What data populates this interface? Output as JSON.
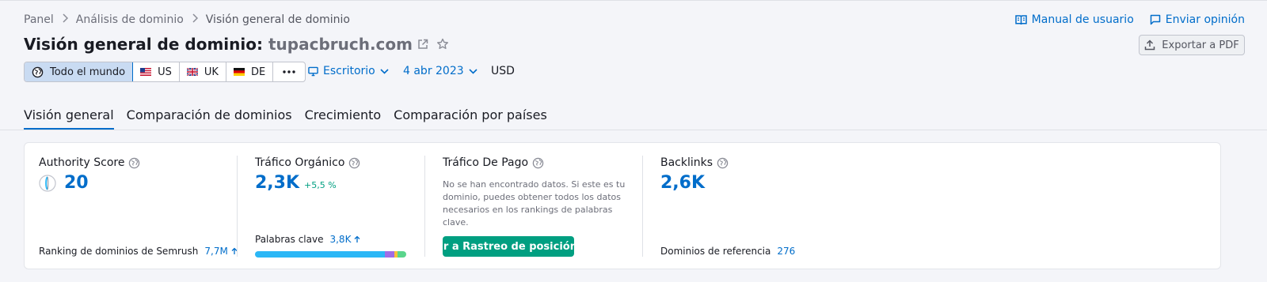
{
  "breadcrumb": [
    "Panel",
    "Análisis de dominio",
    "Visión general de dominio"
  ],
  "toplinks": {
    "manual": "Manual de usuario",
    "feedback": "Enviar opinión"
  },
  "title": {
    "prefix": "Visión general de dominio:",
    "domain": "tupacbruch.com"
  },
  "export_label": "Exportar a PDF",
  "databases": [
    {
      "label": "Todo el mundo",
      "active": true
    },
    {
      "label": "US"
    },
    {
      "label": "UK"
    },
    {
      "label": "DE"
    }
  ],
  "device": "Escritorio",
  "date": "4 abr 2023",
  "currency": "USD",
  "tabs": [
    "Visión general",
    "Comparación de dominios",
    "Crecimiento",
    "Comparación por países"
  ],
  "metrics": {
    "authority": {
      "label": "Authority Score",
      "value": "20",
      "rank_label": "Ranking de dominios de Semrush",
      "rank_value": "7,7M"
    },
    "organic": {
      "label": "Tráfico Orgánico",
      "value": "2,3K",
      "delta": "+5,5 %",
      "kw_label": "Palabras clave",
      "kw_value": "3,8K",
      "kw_distribution": [
        {
          "share": 0.857,
          "color": "#2bb7f6"
        },
        {
          "share": 0.065,
          "color": "#a06ce6"
        },
        {
          "share": 0.02,
          "color": "#f9c13a"
        },
        {
          "share": 0.058,
          "color": "#5ad58c"
        }
      ]
    },
    "paid": {
      "label": "Tráfico De Pago",
      "nodata": "No se han encontrado datos. Si este es tu dominio, puedes obtener todos los datos necesarios en los rankings de palabras clave.",
      "cta": "Ir a Rastreo de posición"
    },
    "backlinks": {
      "label": "Backlinks",
      "value": "2,6K",
      "ref_label": "Dominios de referencia",
      "ref_value": "276"
    }
  },
  "colors": {
    "accent": "#006dca",
    "positive": "#009f81"
  }
}
